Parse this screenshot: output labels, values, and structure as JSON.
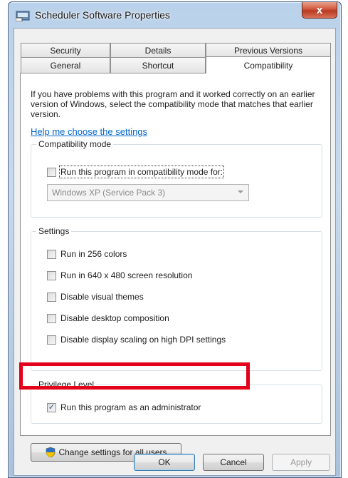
{
  "window": {
    "title": "Scheduler Software Properties",
    "close_label": "x"
  },
  "tabs": {
    "row1": [
      {
        "label": "Security"
      },
      {
        "label": "Details"
      },
      {
        "label": "Previous Versions"
      }
    ],
    "row2": [
      {
        "label": "General"
      },
      {
        "label": "Shortcut"
      },
      {
        "label": "Compatibility",
        "active": true
      }
    ]
  },
  "compatibility": {
    "intro": "If you have problems with this program and it worked correctly on an earlier version of Windows, select the compatibility mode that matches that earlier version.",
    "help_link": "Help me choose the settings",
    "mode_group": {
      "label": "Compatibility mode",
      "checkbox_label": "Run this program in compatibility mode for:",
      "checked": false,
      "selected_os": "Windows XP (Service Pack 3)"
    },
    "settings_group": {
      "label": "Settings",
      "options": [
        {
          "label": "Run in 256 colors",
          "checked": false
        },
        {
          "label": "Run in 640 x 480 screen resolution",
          "checked": false
        },
        {
          "label": "Disable visual themes",
          "checked": false
        },
        {
          "label": "Disable desktop composition",
          "checked": false
        },
        {
          "label": "Disable display scaling on high DPI settings",
          "checked": false
        }
      ]
    },
    "privilege_group": {
      "label": "Privilege Level",
      "checkbox_label": "Run this program as an administrator",
      "checked": true,
      "check_glyph": "✓"
    },
    "change_all_users": "Change settings for all users"
  },
  "buttons": {
    "ok": "OK",
    "cancel": "Cancel",
    "apply": "Apply"
  },
  "colors": {
    "highlight_box": "#e3001b",
    "link": "#0066cc"
  }
}
